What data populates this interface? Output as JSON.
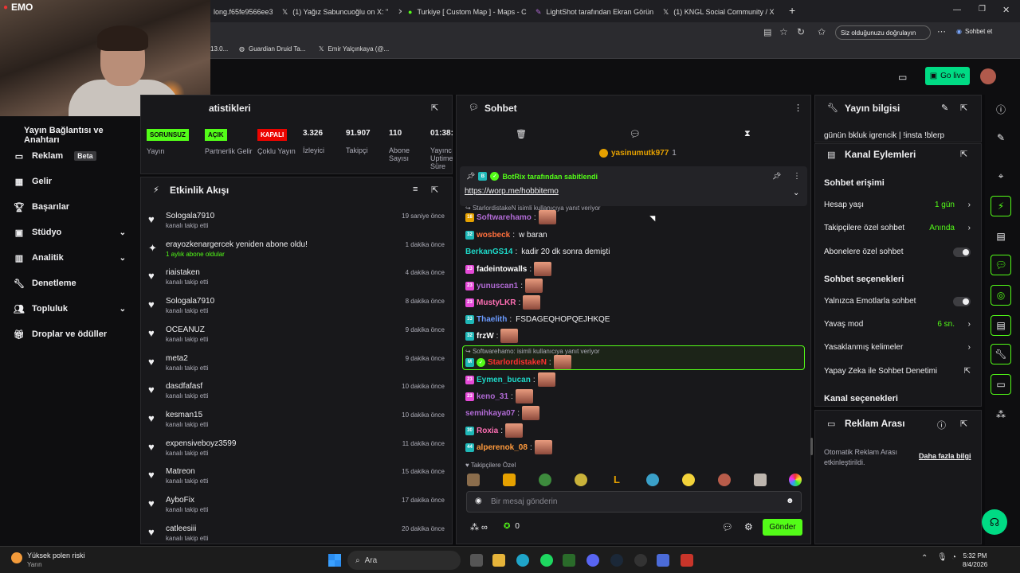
{
  "browser": {
    "tabs": [
      {
        "label": "long.f65fe9566ee3b"
      },
      {
        "label": "(1) Yağız Sabuncuoğlu on X: \""
      },
      {
        "label": "Turkiye [ Custom Map ] - Maps - C"
      },
      {
        "label": "LightShot tarafından Ekran Görün"
      },
      {
        "label": "(1) KNGL Social Community / X"
      }
    ],
    "verify_label": "Siz olduğunuzu doğrulayın",
    "chat_label": "Sohbet et",
    "bookmarks": [
      {
        "label": "13.0..."
      },
      {
        "label": "Guardian Druid Ta..."
      },
      {
        "label": "Emir Yalçınkaya (@..."
      }
    ]
  },
  "webcam": {
    "tag": "EMO"
  },
  "header": {
    "go_live": "Go live"
  },
  "sidebar": {
    "stream_key": "Yayın Bağlantısı ve Anahtarı",
    "items": [
      {
        "label": "Reklam",
        "badge": "Beta"
      },
      {
        "label": "Gelir"
      },
      {
        "label": "Başarılar"
      },
      {
        "label": "Stüdyo"
      },
      {
        "label": "Analitik"
      },
      {
        "label": "Denetleme"
      },
      {
        "label": "Topluluk"
      },
      {
        "label": "Droplar ve ödüller"
      }
    ]
  },
  "stats": {
    "title": "atistikleri",
    "cols": [
      {
        "badge": "SORUNSUZ",
        "label": "Yayın",
        "color": "#53fc18"
      },
      {
        "badge": "AÇIK",
        "label": "Partnerlik Gelir",
        "color": "#53fc18"
      },
      {
        "badge": "KAPALI",
        "label": "Çoklu Yayın",
        "color": "#eb0400"
      },
      {
        "value": "3.326",
        "label": "İzleyici"
      },
      {
        "value": "91.907",
        "label": "Takipçi"
      },
      {
        "value": "110",
        "label": "Abone Sayısı"
      },
      {
        "value": "01:38:",
        "label": "Yayınc Uptime Süre"
      }
    ]
  },
  "activity": {
    "title": "Etkinlik Akışı",
    "items": [
      {
        "name": "Sologala7910",
        "sub": "kanalı takip etti",
        "time": "19 saniye önce",
        "icon": "heart"
      },
      {
        "name": "erayozkenargercek yeniden abone oldu!",
        "sub": "1 aylık abone oldular",
        "time": "1 dakika önce",
        "icon": "star"
      },
      {
        "name": "riaistaken",
        "sub": "kanalı takip etti",
        "time": "4 dakika önce",
        "icon": "heart"
      },
      {
        "name": "Sologala7910",
        "sub": "kanalı takip etti",
        "time": "8 dakika önce",
        "icon": "heart"
      },
      {
        "name": "OCEANUZ",
        "sub": "kanalı takip etti",
        "time": "9 dakika önce",
        "icon": "heart"
      },
      {
        "name": "meta2",
        "sub": "kanalı takip etti",
        "time": "9 dakika önce",
        "icon": "heart"
      },
      {
        "name": "dasdfafasf",
        "sub": "kanalı takip etti",
        "time": "10 dakika önce",
        "icon": "heart"
      },
      {
        "name": "kesman15",
        "sub": "kanalı takip etti",
        "time": "10 dakika önce",
        "icon": "heart"
      },
      {
        "name": "expensiveboyz3599",
        "sub": "kanalı takip etti",
        "time": "11 dakika önce",
        "icon": "heart"
      },
      {
        "name": "Matreon",
        "sub": "kanalı takip etti",
        "time": "15 dakika önce",
        "icon": "heart"
      },
      {
        "name": "AyboFix",
        "sub": "kanalı takip etti",
        "time": "17 dakika önce",
        "icon": "heart"
      },
      {
        "name": "catleesiii",
        "sub": "kanalı takip etti",
        "time": "20 dakika önce",
        "icon": "heart"
      }
    ]
  },
  "chat": {
    "title": "Sohbet",
    "top_gifter": "yasinumutk977",
    "top_gifter_count": "1",
    "pinned_by": "BotRix tarafından sabitlendi",
    "pinned_link": "https://worp.me/hobbitemo",
    "reply1": "StarlordistakeN isimli kullanıcıya yanıt veriyor",
    "reply2": "Softwarehamo: isimli kullanıcıya yanıt veriyor",
    "messages": [
      {
        "badge": "18",
        "badge_color": "#e6a100",
        "user": "Softwarehamo",
        "color": "#b06ad4",
        "text": "",
        "emote": true
      },
      {
        "badge": "32",
        "badge_color": "#1fb8b8",
        "user": "wosbeck",
        "color": "#ff6f3c",
        "text": "w baran",
        "emote": false
      },
      {
        "badge": "",
        "badge_color": "",
        "user": "BerkanGS14",
        "color": "#1ed8c8",
        "text": "kadir 20 dk sonra demişti",
        "emote": false
      },
      {
        "badge": "23",
        "badge_color": "#e64ad8",
        "user": "fadeintowalls",
        "color": "#ffffff",
        "text": "",
        "emote": true
      },
      {
        "badge": "23",
        "badge_color": "#e64ad8",
        "user": "yunuscan1",
        "color": "#b06ad4",
        "text": "",
        "emote": true
      },
      {
        "badge": "23",
        "badge_color": "#e64ad8",
        "user": "MustyLKR",
        "color": "#ff6fb4",
        "text": "",
        "emote": true
      },
      {
        "badge": "33",
        "badge_color": "#1fb8b8",
        "user": "Thaelith",
        "color": "#6b9bff",
        "text": "FSDAGEQHOPQEJHKQE",
        "emote": false
      },
      {
        "badge": "32",
        "badge_color": "#1fb8b8",
        "user": "frzW",
        "color": "#ffffff",
        "text": "",
        "emote": true
      },
      {
        "badge": "",
        "badge_color": "",
        "user": "StarlordistakeN",
        "color": "#ff3030",
        "text": "",
        "emote": true
      },
      {
        "badge": "23",
        "badge_color": "#e64ad8",
        "user": "Eymen_bucan",
        "color": "#1ed8c8",
        "text": "",
        "emote": true
      },
      {
        "badge": "23",
        "badge_color": "#e64ad8",
        "user": "keno_31",
        "color": "#b06ad4",
        "text": "",
        "emote": true
      },
      {
        "badge": "",
        "badge_color": "",
        "user": "semihkaya07",
        "color": "#b06ad4",
        "text": "",
        "emote": true
      },
      {
        "badge": "30",
        "badge_color": "#1fb8b8",
        "user": "Roxia",
        "color": "#ff6fb4",
        "text": "",
        "emote": true
      },
      {
        "badge": "44",
        "badge_color": "#1fb8b8",
        "user": "alperenok_08",
        "color": "#ff9a3c",
        "text": "",
        "emote": true
      }
    ],
    "followers_only": "Takipçilere Özel",
    "placeholder": "Bir mesaj gönderin",
    "points": "0",
    "send": "Gönder"
  },
  "right": {
    "stream_info_title": "Yayın bilgisi",
    "stream_title": "günün bkluk igrencik | !insta !blerp",
    "actions_title": "Kanal Eylemleri",
    "chat_access": "Sohbet erişimi",
    "account_age": "Hesap yaşı",
    "account_age_val": "1 gün",
    "followers_chat": "Takipçilere özel sohbet",
    "followers_chat_val": "Anında",
    "subs_chat": "Abonelere özel sohbet",
    "chat_options": "Sohbet seçenekleri",
    "emote_only": "Yalnızca Emotlarla sohbet",
    "slow_mode": "Yavaş mod",
    "slow_mode_val": "6 sn.",
    "banned_words": "Yasaklanmış kelimeler",
    "ai_moderation": "Yapay Zeka ile Sohbet Denetimi",
    "channel_options": "Kanal seçenekleri",
    "ad_break_title": "Reklam Arası",
    "ad_break_text": "Otomatik Reklam Arası etkinleştirildi.",
    "ad_break_link": "Daha fazla bilgi"
  },
  "taskbar": {
    "weather_title": "Yüksek polen riski",
    "weather_sub": "Yarın",
    "search": "Ara",
    "time": "5:32 PM",
    "date": "8/4/2026"
  },
  "colors": {
    "accent": "#53fc18",
    "bg": "#0e0e10",
    "panel": "#18181b"
  }
}
